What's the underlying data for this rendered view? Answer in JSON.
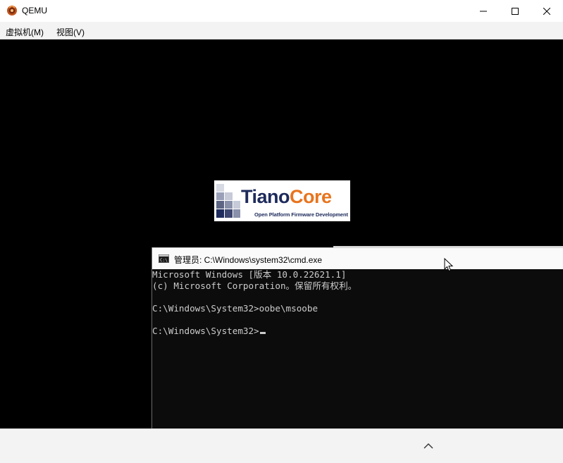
{
  "window": {
    "title": "QEMU",
    "icon": "qemu-logo-icon"
  },
  "menubar": {
    "items": [
      {
        "label": "虚拟机(M)"
      },
      {
        "label": "视图(V)"
      }
    ]
  },
  "logo": {
    "name_part1": "Tiano",
    "name_part2": "Core",
    "tagline": "Open Platform Firmware Development",
    "colors": {
      "dark": "#1d2a5b",
      "orange": "#e8741e"
    }
  },
  "cmd": {
    "title": "管理员: C:\\Windows\\system32\\cmd.exe",
    "icon": "cmd-icon",
    "lines": [
      "Microsoft Windows [版本 10.0.22621.1]",
      "(c) Microsoft Corporation。保留所有权利。",
      "C:\\Windows\\System32>oobe\\msoobe",
      "C:\\Windows\\System32>"
    ],
    "colors": {
      "background": "#0c0c0c",
      "text": "#cccccc"
    }
  },
  "bottombar": {
    "expand_icon": "chevron-up-icon"
  }
}
